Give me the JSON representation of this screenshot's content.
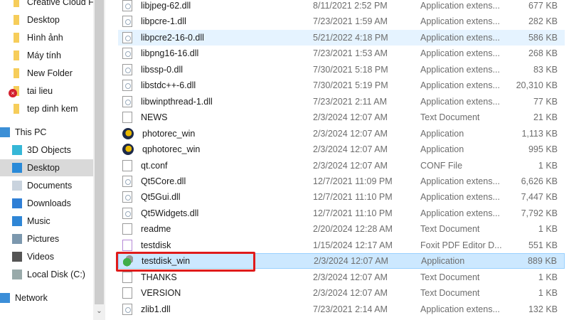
{
  "nav": {
    "items": [
      {
        "label": "Creative Cloud F",
        "icon": "folder-icon"
      },
      {
        "label": "Desktop",
        "icon": "folder-icon"
      },
      {
        "label": "Hình ảnh",
        "icon": "folder-icon"
      },
      {
        "label": "Máy tính",
        "icon": "folder-icon"
      },
      {
        "label": "New Folder",
        "icon": "folder-icon"
      },
      {
        "label": "tai lieu",
        "icon": "folder-error-icon"
      },
      {
        "label": "tep dinh kem",
        "icon": "folder-icon"
      },
      {
        "label": "This PC",
        "icon": "computer-icon"
      },
      {
        "label": "3D Objects",
        "icon": "cube-icon"
      },
      {
        "label": "Desktop",
        "icon": "desktop-icon"
      },
      {
        "label": "Documents",
        "icon": "documents-icon"
      },
      {
        "label": "Downloads",
        "icon": "download-arrow-icon"
      },
      {
        "label": "Music",
        "icon": "music-note-icon"
      },
      {
        "label": "Pictures",
        "icon": "pictures-icon"
      },
      {
        "label": "Videos",
        "icon": "film-icon"
      },
      {
        "label": "Local Disk (C:)",
        "icon": "drive-icon"
      },
      {
        "label": "Network",
        "icon": "network-icon"
      }
    ]
  },
  "files": [
    {
      "name": "libjpeg-62.dll",
      "date": "8/11/2021 2:52 PM",
      "type": "Application extens...",
      "size": "677 KB",
      "icon": "dll"
    },
    {
      "name": "libpcre-1.dll",
      "date": "7/23/2021 1:59 AM",
      "type": "Application extens...",
      "size": "282 KB",
      "icon": "dll"
    },
    {
      "name": "libpcre2-16-0.dll",
      "date": "5/21/2022 4:18 PM",
      "type": "Application extens...",
      "size": "586 KB",
      "icon": "dll"
    },
    {
      "name": "libpng16-16.dll",
      "date": "7/23/2021 1:53 AM",
      "type": "Application extens...",
      "size": "268 KB",
      "icon": "dll"
    },
    {
      "name": "libssp-0.dll",
      "date": "7/30/2021 5:18 PM",
      "type": "Application extens...",
      "size": "83 KB",
      "icon": "dll"
    },
    {
      "name": "libstdc++-6.dll",
      "date": "7/30/2021 5:19 PM",
      "type": "Application extens...",
      "size": "20,310 KB",
      "icon": "dll"
    },
    {
      "name": "libwinpthread-1.dll",
      "date": "7/23/2021 2:11 AM",
      "type": "Application extens...",
      "size": "77 KB",
      "icon": "dll"
    },
    {
      "name": "NEWS",
      "date": "2/3/2024 12:07 AM",
      "type": "Text Document",
      "size": "21 KB",
      "icon": "txt"
    },
    {
      "name": "photorec_win",
      "date": "2/3/2024 12:07 AM",
      "type": "Application",
      "size": "1,113 KB",
      "icon": "app"
    },
    {
      "name": "qphotorec_win",
      "date": "2/3/2024 12:07 AM",
      "type": "Application",
      "size": "995 KB",
      "icon": "app"
    },
    {
      "name": "qt.conf",
      "date": "2/3/2024 12:07 AM",
      "type": "CONF File",
      "size": "1 KB",
      "icon": "blank"
    },
    {
      "name": "Qt5Core.dll",
      "date": "12/7/2021 11:09 PM",
      "type": "Application extens...",
      "size": "6,626 KB",
      "icon": "dll"
    },
    {
      "name": "Qt5Gui.dll",
      "date": "12/7/2021 11:10 PM",
      "type": "Application extens...",
      "size": "7,447 KB",
      "icon": "dll"
    },
    {
      "name": "Qt5Widgets.dll",
      "date": "12/7/2021 11:10 PM",
      "type": "Application extens...",
      "size": "7,792 KB",
      "icon": "dll"
    },
    {
      "name": "readme",
      "date": "2/20/2024 12:28 AM",
      "type": "Text Document",
      "size": "1 KB",
      "icon": "txt"
    },
    {
      "name": "testdisk",
      "date": "1/15/2024 12:17 AM",
      "type": "Foxit PDF Editor D...",
      "size": "551 KB",
      "icon": "pdf"
    },
    {
      "name": "testdisk_win",
      "date": "2/3/2024 12:07 AM",
      "type": "Application",
      "size": "889 KB",
      "icon": "td"
    },
    {
      "name": "THANKS",
      "date": "2/3/2024 12:07 AM",
      "type": "Text Document",
      "size": "1 KB",
      "icon": "txt"
    },
    {
      "name": "VERSION",
      "date": "2/3/2024 12:07 AM",
      "type": "Text Document",
      "size": "1 KB",
      "icon": "txt"
    },
    {
      "name": "zlib1.dll",
      "date": "7/23/2021 2:14 AM",
      "type": "Application extens...",
      "size": "132 KB",
      "icon": "dll"
    }
  ],
  "hovered_index": 2,
  "selected_index": 16
}
